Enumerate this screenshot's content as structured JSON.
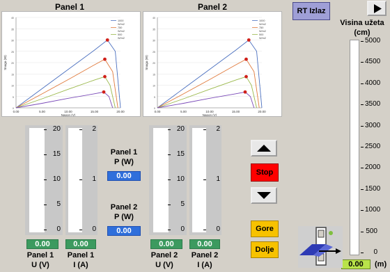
{
  "panel1": {
    "title": "Panel 1",
    "chart": {
      "ylabel": "Snaga (W)",
      "xlabel": "Napon (V)",
      "x_ticks": [
        "0.00",
        "5.00",
        "10.00",
        "15.00",
        "20.00"
      ],
      "legend": [
        "1000",
        "W/m2",
        "750",
        "W/m2",
        "500",
        "W/m2"
      ]
    },
    "gauge_u": {
      "ticks": [
        "20",
        "15",
        "10",
        "5",
        "0"
      ],
      "value": "0.00",
      "label1": "Panel 1",
      "label2": "U (V)"
    },
    "gauge_i": {
      "ticks": [
        "2",
        "1",
        "0"
      ],
      "value": "0.00",
      "label1": "Panel 1",
      "label2": "I (A)"
    }
  },
  "panel2": {
    "title": "Panel 2",
    "chart": {
      "ylabel": "Snaga (W)",
      "xlabel": "Napon (V)",
      "x_ticks": [
        "0.00",
        "5.00",
        "10.00",
        "15.00",
        "20.00"
      ],
      "legend": [
        "1000",
        "W/m2",
        "750",
        "W/m2",
        "500",
        "W/m2"
      ]
    },
    "gauge_u": {
      "ticks": [
        "20",
        "15",
        "10",
        "5",
        "0"
      ],
      "value": "0.00",
      "label1": "Panel 2",
      "label2": "U (V)"
    },
    "gauge_i": {
      "ticks": [
        "2",
        "1",
        "0"
      ],
      "value": "0.00",
      "label1": "Panel 2",
      "label2": "I (A)"
    }
  },
  "power": {
    "p1_label1": "Panel 1",
    "p1_label2": "P (W)",
    "p1_value": "0.00",
    "p2_label1": "Panel 2",
    "p2_label2": "P (W)",
    "p2_value": "0.00"
  },
  "controls": {
    "stop": "Stop",
    "gore": "Gore",
    "dolje": "Dolje"
  },
  "header": {
    "rt_button": "RT Izlaz"
  },
  "height_gauge": {
    "title1": "Visina užeta",
    "title2": "(cm)",
    "ticks": [
      "5000",
      "4500",
      "4000",
      "3500",
      "3000",
      "2500",
      "2000",
      "1500",
      "1000",
      "500",
      "0"
    ],
    "value": "0.00",
    "unit": "(m)"
  },
  "colors": {
    "stop": "#ff0000",
    "gore": "#f7c200",
    "value_green": "#3c9a5f",
    "value_blue": "#2f6fdb",
    "rt_button": "#9f9fd6"
  },
  "chart_data": {
    "type": "line",
    "xlabel": "Napon (V)",
    "ylabel": "Snaga (W)",
    "xlim": [
      0,
      20
    ],
    "ylim": [
      0,
      40
    ],
    "series": [
      {
        "name": "1000 W/m2",
        "x": [
          0,
          5,
          10,
          15,
          17.5,
          19,
          20
        ],
        "y": [
          0,
          8.5,
          17,
          25.5,
          30,
          25,
          0
        ]
      },
      {
        "name": "750 W/m2",
        "x": [
          0,
          5,
          10,
          15,
          17,
          18.5,
          19.5
        ],
        "y": [
          0,
          6.2,
          12.5,
          19,
          21.5,
          16,
          0
        ]
      },
      {
        "name": "500 W/m2",
        "x": [
          0,
          5,
          10,
          15,
          17,
          18,
          19
        ],
        "y": [
          0,
          4,
          8.2,
          12.3,
          13.8,
          10,
          0
        ]
      },
      {
        "name": "",
        "x": [
          0,
          5,
          10,
          15,
          16.8,
          17.8,
          18.5
        ],
        "y": [
          0,
          2,
          4.2,
          6.2,
          7,
          5,
          0
        ]
      }
    ]
  }
}
